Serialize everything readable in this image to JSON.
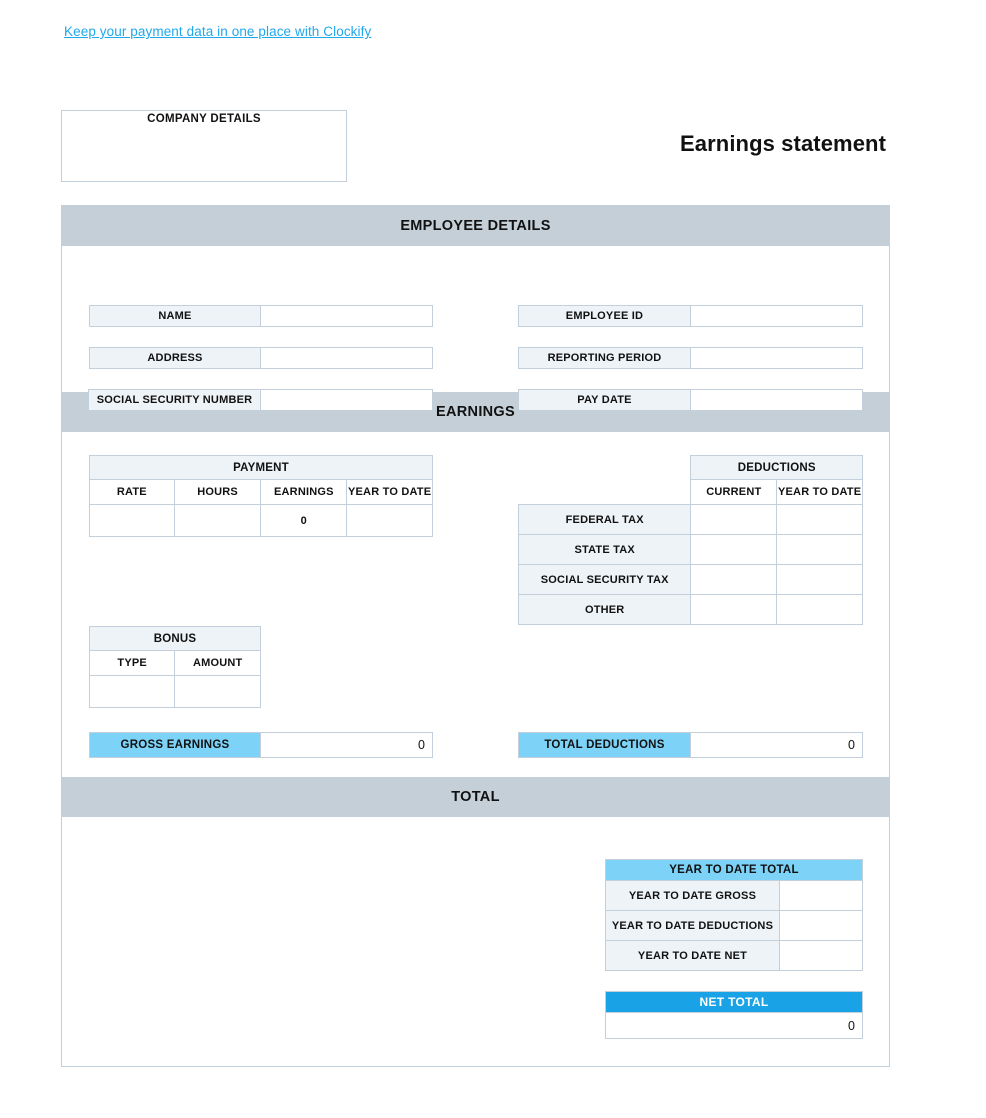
{
  "promo": {
    "text": "Keep your payment data in one place with Clockify",
    "color": "#1fa8ec"
  },
  "header": {
    "company_box_label": "COMPANY DETAILS",
    "document_title": "Earnings statement"
  },
  "sections": {
    "employee_details_title": "EMPLOYEE DETAILS",
    "earnings_title": "EARNINGS",
    "total_title": "TOTAL"
  },
  "employee_details": {
    "left_fields": [
      {
        "label": "NAME",
        "value": ""
      },
      {
        "label": "ADDRESS",
        "value": ""
      },
      {
        "label": "SOCIAL SECURITY NUMBER",
        "value": ""
      }
    ],
    "right_fields": [
      {
        "label": "EMPLOYEE ID",
        "value": ""
      },
      {
        "label": "REPORTING PERIOD",
        "value": ""
      },
      {
        "label": "PAY DATE",
        "value": ""
      }
    ]
  },
  "payment_table": {
    "caption": "PAYMENT",
    "columns": [
      "RATE",
      "HOURS",
      "EARNINGS",
      "YEAR TO DATE"
    ],
    "rows": [
      {
        "rate": "",
        "hours": "",
        "earnings": "0",
        "year_to_date": ""
      }
    ]
  },
  "bonus_table": {
    "caption": "BONUS",
    "columns": [
      "TYPE",
      "AMOUNT"
    ],
    "rows": [
      {
        "type": "",
        "amount": ""
      }
    ]
  },
  "deductions_table": {
    "caption": "DEDUCTIONS",
    "columns": [
      "CURRENT",
      "YEAR TO DATE"
    ],
    "rows": [
      {
        "label": "FEDERAL TAX",
        "current": "",
        "year_to_date": ""
      },
      {
        "label": "STATE TAX",
        "current": "",
        "year_to_date": ""
      },
      {
        "label": "SOCIAL SECURITY TAX",
        "current": "",
        "year_to_date": ""
      },
      {
        "label": "OTHER",
        "current": "",
        "year_to_date": ""
      }
    ]
  },
  "totals": {
    "gross_earnings_label": "GROSS EARNINGS",
    "gross_earnings_value": "0",
    "total_deductions_label": "TOTAL DEDUCTIONS",
    "total_deductions_value": "0"
  },
  "year_to_date_total": {
    "caption": "YEAR TO DATE TOTAL",
    "rows": [
      {
        "label": "YEAR TO DATE GROSS",
        "value": ""
      },
      {
        "label": "YEAR TO DATE DEDUCTIONS",
        "value": ""
      },
      {
        "label": "YEAR TO DATE NET",
        "value": ""
      }
    ]
  },
  "net_total": {
    "caption": "NET TOTAL",
    "value": "0"
  },
  "colors": {
    "band": "#c4cfd8",
    "label_cell": "#eef3f7",
    "accent_light": "#7dd3f7",
    "accent_strong": "#19a3e6",
    "border": "#c3d0dc",
    "link": "#1fa8ec"
  }
}
